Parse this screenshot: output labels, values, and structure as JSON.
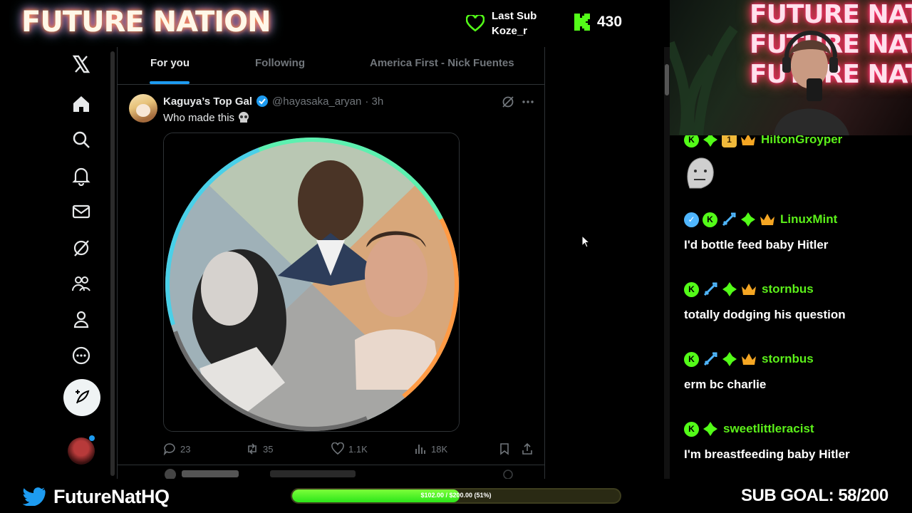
{
  "overlay": {
    "brand": "FUTURE NATION",
    "last_sub_label": "Last Sub",
    "last_sub_name": "Koze_r",
    "kick_count": "430",
    "webcam_neon_lines": [
      "FUTURE NATION",
      "FUTURE NATION",
      "FUTURE NATION"
    ]
  },
  "x": {
    "nav": [
      "x-logo",
      "home",
      "search",
      "notifications",
      "messages",
      "grok",
      "communities",
      "profile",
      "more"
    ],
    "tabs": [
      {
        "label": "For you",
        "active": true
      },
      {
        "label": "Following",
        "active": false
      },
      {
        "label": "America First - Nick Fuentes",
        "active": false
      }
    ],
    "tweet": {
      "author": "Kaguya’s Top Gal",
      "handle": "@hayasaka_aryan",
      "time": "· 3h",
      "text": "Who made this",
      "replies": "23",
      "reposts": "35",
      "likes": "1.1K",
      "views": "18K"
    }
  },
  "chat": {
    "messages": [
      {
        "user": "HiltonGroyper",
        "badges": [
          "kick",
          "gem",
          "tier",
          "crown"
        ],
        "text": "",
        "emote": "npc-emote"
      },
      {
        "user": "LinuxMint",
        "badges": [
          "verified",
          "kick",
          "sword",
          "gem",
          "crown"
        ],
        "text": "I'd bottle feed baby Hitler"
      },
      {
        "user": "stornbus",
        "badges": [
          "kick",
          "sword",
          "gem",
          "crown"
        ],
        "text": "totally dodging his question"
      },
      {
        "user": "stornbus",
        "badges": [
          "kick",
          "sword",
          "gem",
          "crown"
        ],
        "text": "erm bc charlie"
      },
      {
        "user": "sweetlittleracist",
        "badges": [
          "kick",
          "gem"
        ],
        "text": "I'm breastfeeding baby Hitler"
      }
    ],
    "tier_badge_text": "1"
  },
  "footer": {
    "twitter_handle": "FutureNatHQ",
    "goal_text": "$102.00 / $200.00 (51%)",
    "goal_progress": 0.51,
    "sub_goal": "SUB GOAL: 58/200"
  },
  "colors": {
    "x_blue": "#1d9bf0",
    "kick_green": "#53fc18",
    "chat_username": "#5cf01a"
  }
}
